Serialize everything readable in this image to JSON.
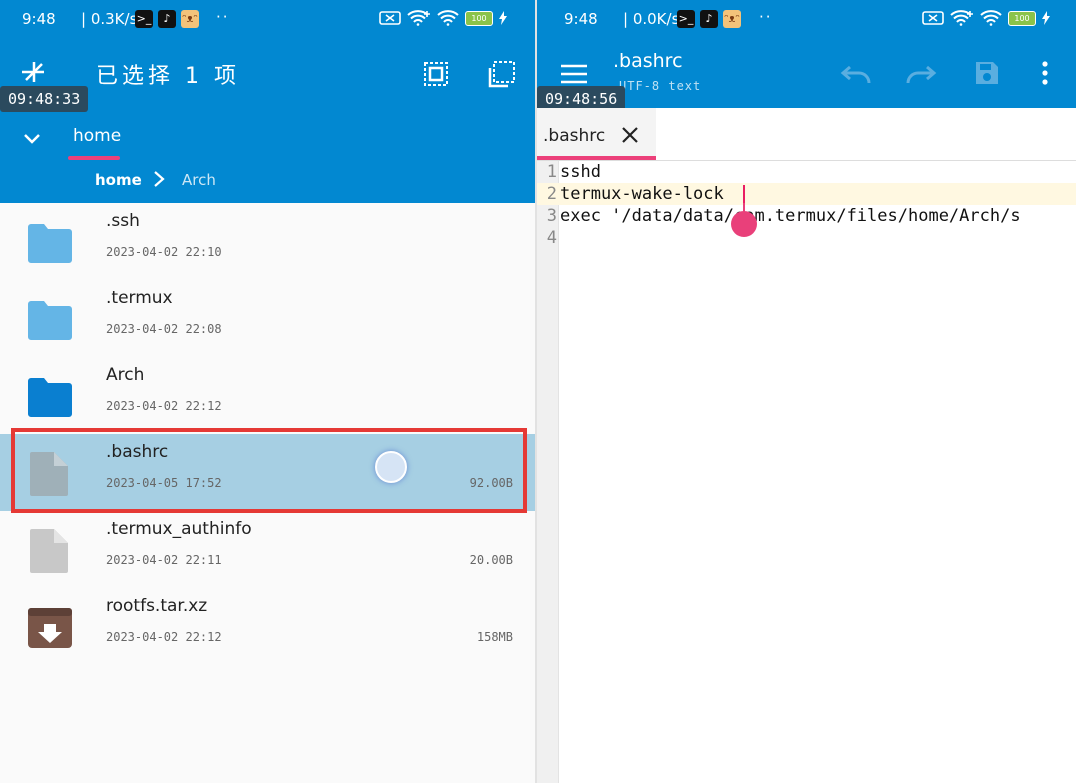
{
  "left": {
    "status": {
      "time": "9:48",
      "net": "| 0.3K/s",
      "dots": "··",
      "battery": "100"
    },
    "timestamp": "09:48:33",
    "selection_title": "已选择 1 项",
    "path_tab": "home",
    "breadcrumb": [
      "home",
      "Arch"
    ],
    "files": [
      {
        "name": ".ssh",
        "date": "2023-04-02 22:10",
        "size": "",
        "type": "folder-light"
      },
      {
        "name": ".termux",
        "date": "2023-04-02 22:08",
        "size": "",
        "type": "folder-light"
      },
      {
        "name": "Arch",
        "date": "2023-04-02 22:12",
        "size": "",
        "type": "folder"
      },
      {
        "name": ".bashrc",
        "date": "2023-04-05 17:52",
        "size": "92.00B",
        "type": "file",
        "selected": true
      },
      {
        "name": ".termux_authinfo",
        "date": "2023-04-02 22:11",
        "size": "20.00B",
        "type": "file"
      },
      {
        "name": "rootfs.tar.xz",
        "date": "2023-04-02 22:12",
        "size": "158MB",
        "type": "archive"
      }
    ],
    "colors": {
      "appbar": "#0288d1",
      "accent": "#ec407a",
      "selected_row": "#a6cfe3",
      "highlight_box": "#e53935"
    }
  },
  "right": {
    "status": {
      "time": "9:48",
      "net": "| 0.0K/s",
      "dots": "··",
      "battery": "100"
    },
    "timestamp": "09:48:56",
    "file_title": ".bashrc",
    "file_subtitle": "UTF-8 text",
    "tab_label": ".bashrc",
    "code_lines": [
      {
        "num": "1",
        "text": "sshd"
      },
      {
        "num": "2",
        "text": "termux-wake-lock"
      },
      {
        "num": "3",
        "text": "exec '/data/data/com.termux/files/home/Arch/s"
      },
      {
        "num": "4",
        "text": ""
      }
    ]
  }
}
